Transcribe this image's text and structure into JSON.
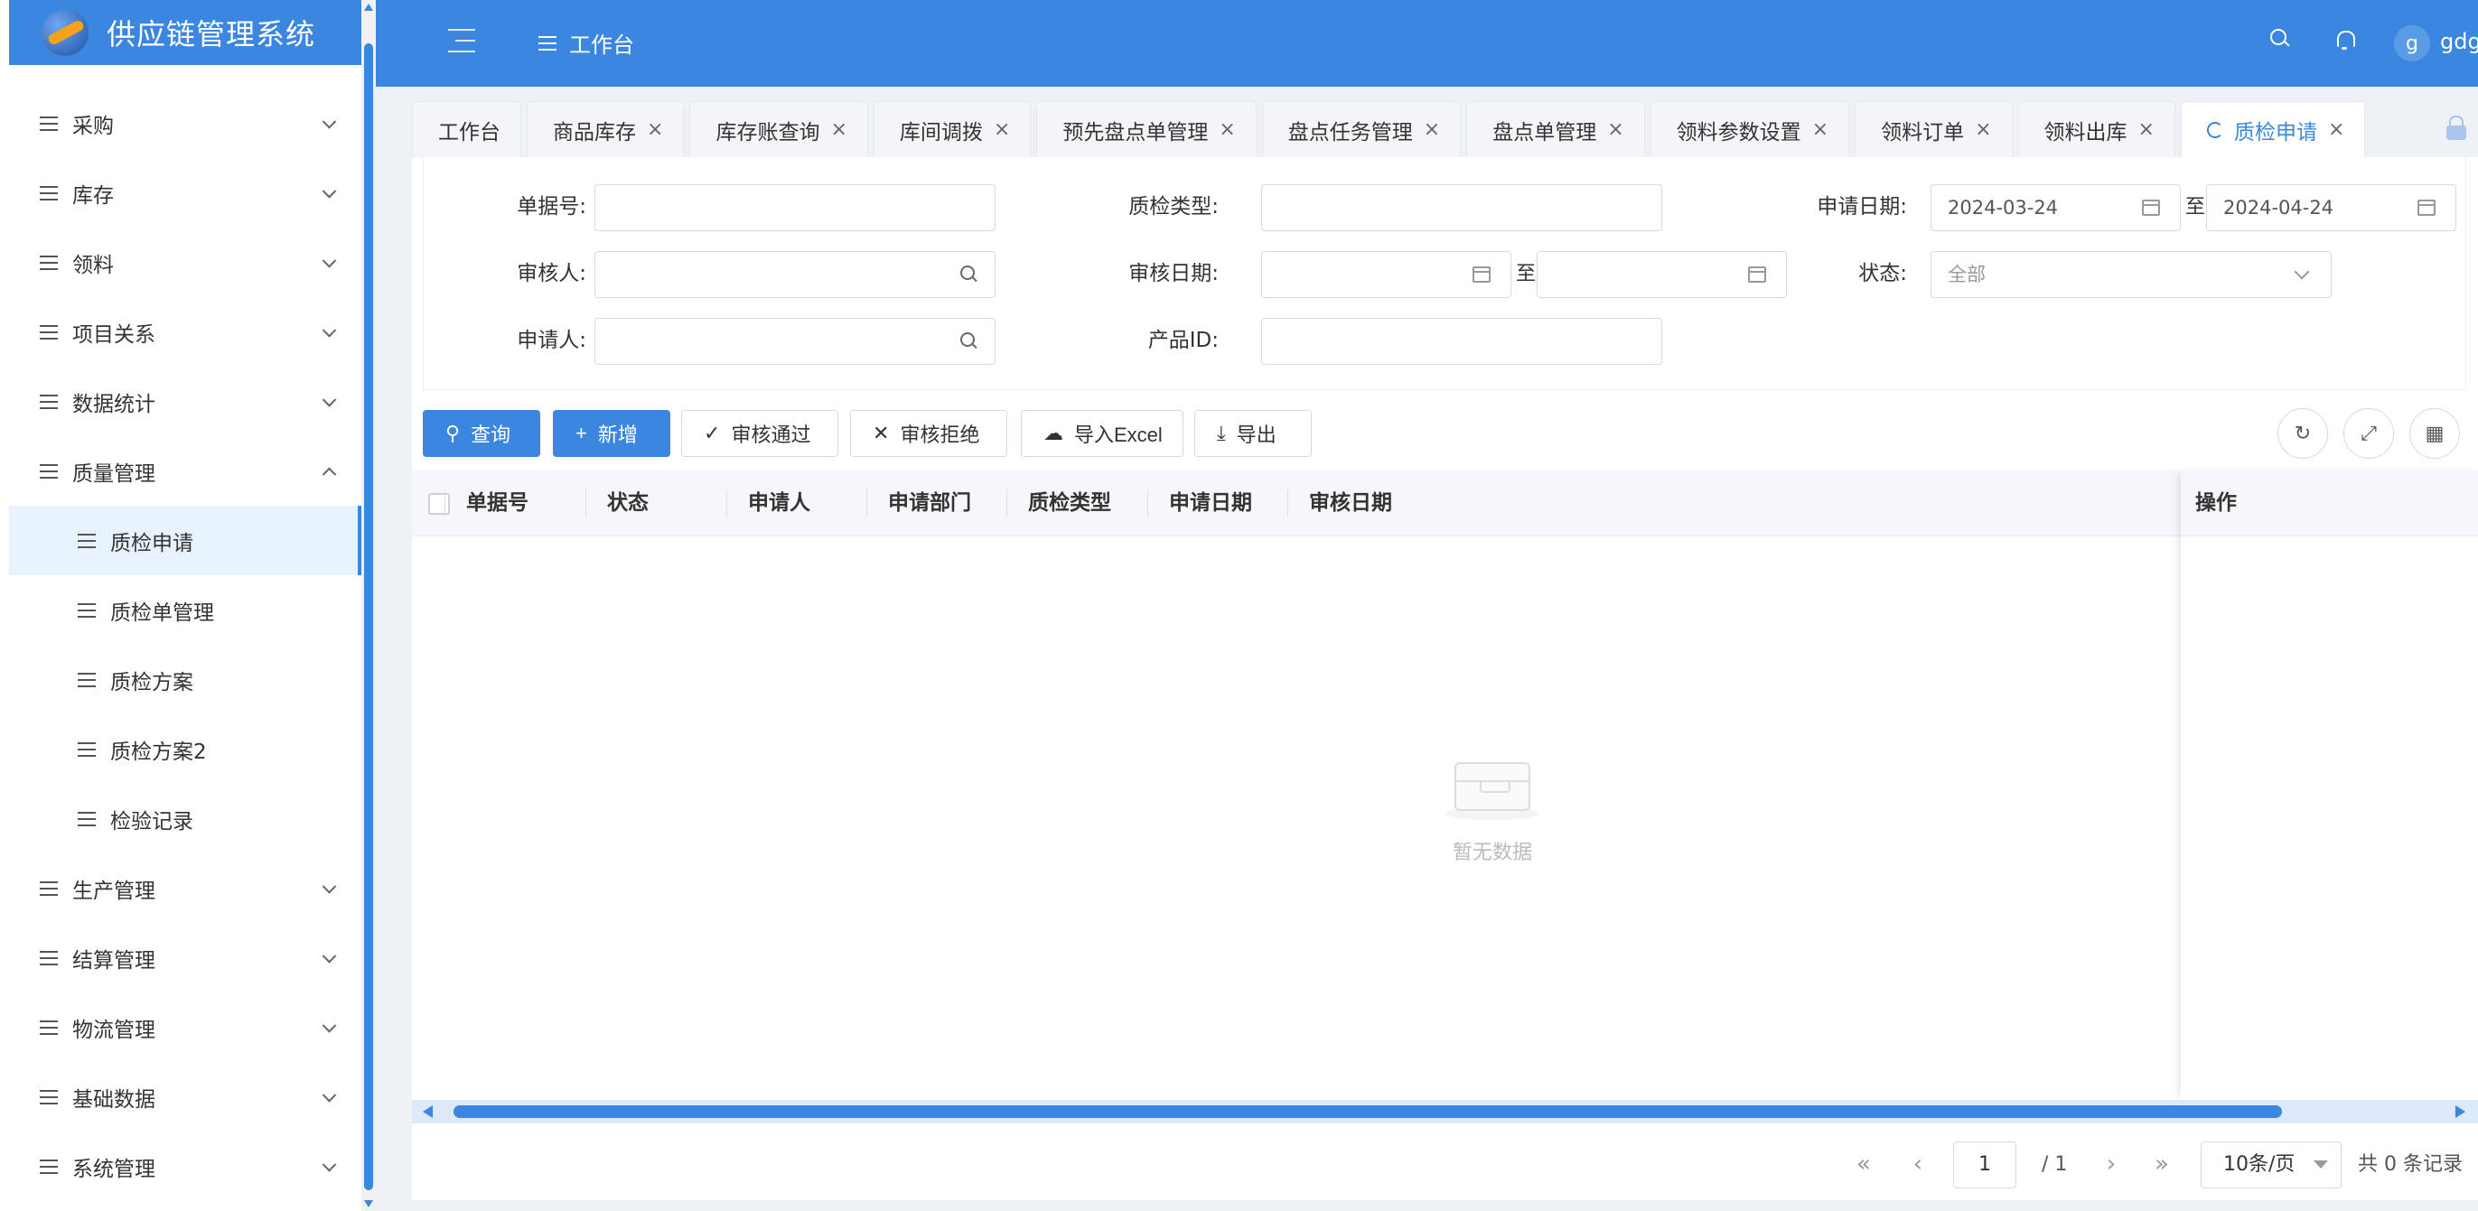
{
  "app": {
    "title": "供应链管理系统"
  },
  "sidebar": {
    "items": [
      {
        "label": "采购",
        "expanded": false
      },
      {
        "label": "库存",
        "expanded": false
      },
      {
        "label": "领料",
        "expanded": false
      },
      {
        "label": "项目关系",
        "expanded": false
      },
      {
        "label": "数据统计",
        "expanded": false
      },
      {
        "label": "质量管理",
        "expanded": true
      },
      {
        "label": "质检申请",
        "sub": true,
        "active": true
      },
      {
        "label": "质检单管理",
        "sub": true
      },
      {
        "label": "质检方案",
        "sub": true
      },
      {
        "label": "质检方案2",
        "sub": true
      },
      {
        "label": "检验记录",
        "sub": true
      },
      {
        "label": "生产管理",
        "expanded": false
      },
      {
        "label": "结算管理",
        "expanded": false
      },
      {
        "label": "物流管理",
        "expanded": false
      },
      {
        "label": "基础数据",
        "expanded": false
      },
      {
        "label": "系统管理",
        "expanded": false
      }
    ]
  },
  "header": {
    "breadcrumb": "工作台",
    "avatar_letter": "g",
    "username": "gdg"
  },
  "tabs": [
    {
      "label": "工作台",
      "closable": false
    },
    {
      "label": "商品库存",
      "closable": true
    },
    {
      "label": "库存账查询",
      "closable": true
    },
    {
      "label": "库间调拨",
      "closable": true
    },
    {
      "label": "预先盘点单管理",
      "closable": true
    },
    {
      "label": "盘点任务管理",
      "closable": true
    },
    {
      "label": "盘点单管理",
      "closable": true
    },
    {
      "label": "领料参数设置",
      "closable": true
    },
    {
      "label": "领料订单",
      "closable": true
    },
    {
      "label": "领料出库",
      "closable": true
    },
    {
      "label": "质检申请",
      "closable": true,
      "active": true
    }
  ],
  "filter": {
    "doc_no_label": "单据号:",
    "qc_type_label": "质检类型:",
    "apply_date_label": "申请日期:",
    "apply_date_from": "2024-03-24",
    "apply_date_to": "2024-04-24",
    "to_label": "至",
    "auditor_label": "审核人:",
    "audit_date_label": "审核日期:",
    "status_label": "状态:",
    "status_value": "全部",
    "applicant_label": "申请人:",
    "product_id_label": "产品ID:"
  },
  "toolbar": {
    "query": "查询",
    "add": "新增",
    "approve": "审核通过",
    "reject": "审核拒绝",
    "import": "导入Excel",
    "export": "导出"
  },
  "table": {
    "columns": [
      "单据号",
      "状态",
      "申请人",
      "申请部门",
      "质检类型",
      "申请日期",
      "审核日期"
    ],
    "op_column": "操作",
    "rows": [],
    "empty_text": "暂无数据"
  },
  "pagination": {
    "current_page": "1",
    "total_pages": "/ 1",
    "page_size": "10条/页",
    "total": "共 0 条记录"
  },
  "colors": {
    "primary": "#3b86de",
    "active_bg": "#e8f2fd"
  }
}
